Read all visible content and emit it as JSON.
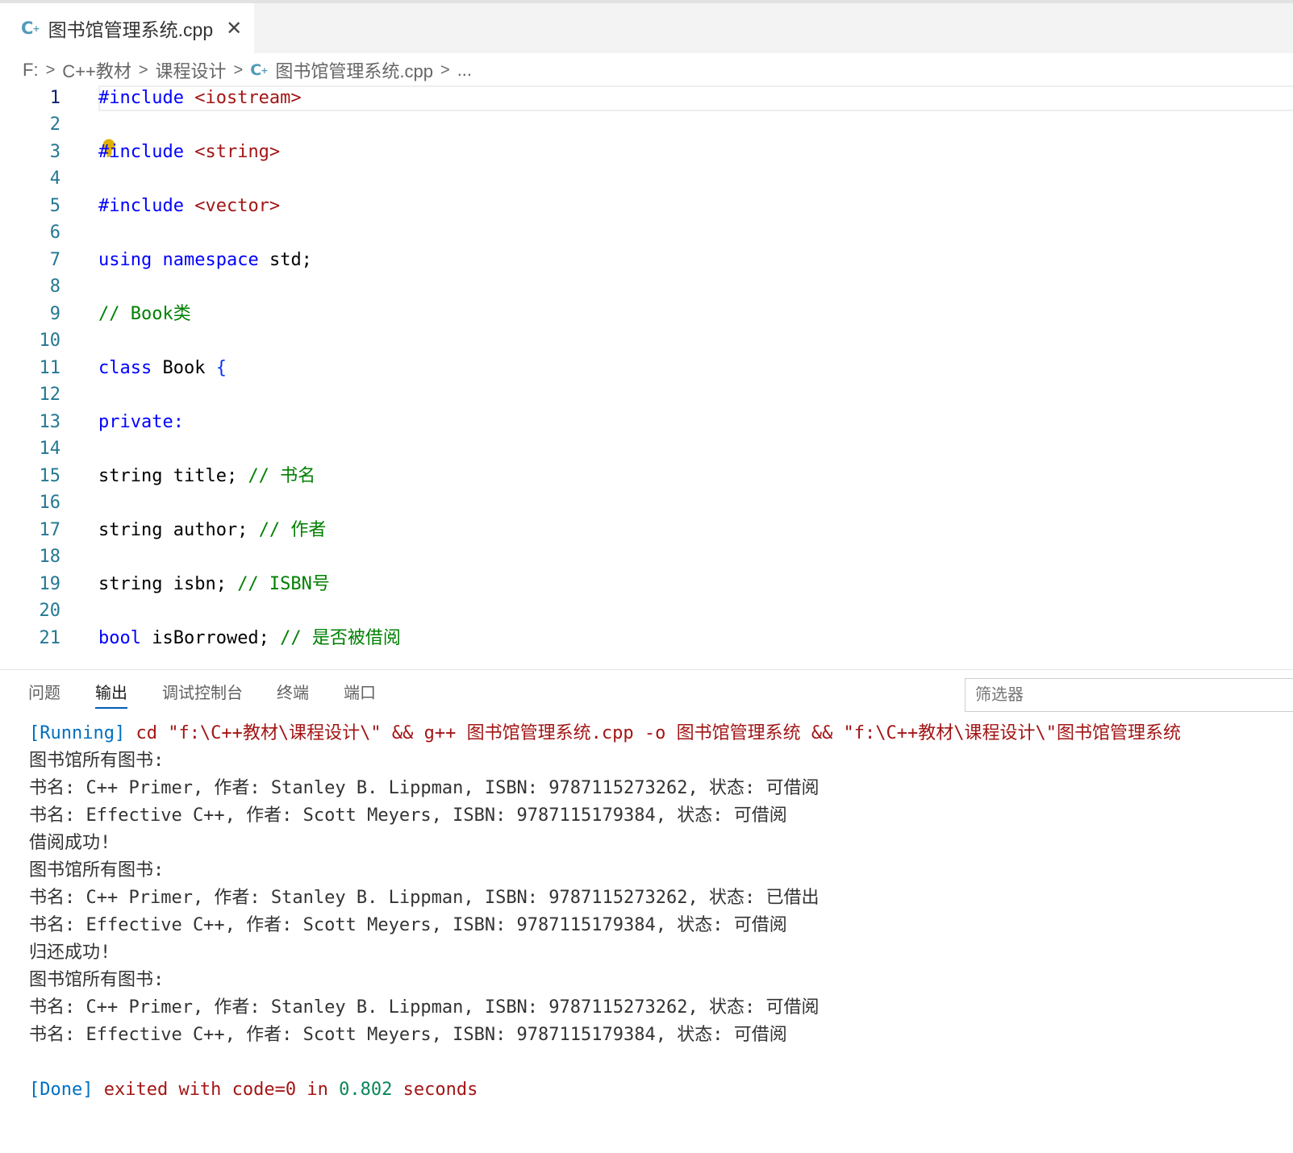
{
  "tab": {
    "icon": "cpp-file-icon",
    "label": "图书馆管理系统.cpp",
    "close": "✕"
  },
  "breadcrumb": {
    "items": [
      "F:",
      "C++教材",
      "课程设计",
      "图书馆管理系统.cpp",
      "..."
    ]
  },
  "editor": {
    "line_numbers": [
      "1",
      "2",
      "3",
      "4",
      "5",
      "6",
      "7",
      "8",
      "9",
      "10",
      "11",
      "12",
      "13",
      "14",
      "15",
      "16",
      "17",
      "18",
      "19",
      "20",
      "21"
    ],
    "lines": {
      "l1": {
        "kw": "#include",
        "inc": " <iostream>"
      },
      "l3": {
        "kw": "#include",
        "inc": " <string>"
      },
      "l5": {
        "kw": "#include",
        "inc": " <vector>"
      },
      "l7": {
        "kw1": "using",
        "sp": " ",
        "kw2": "namespace",
        "rest": " std;"
      },
      "l9": {
        "cm": "// Book类"
      },
      "l11": {
        "kw": "class",
        "rest": " Book ",
        "br": "{"
      },
      "l13": {
        "kw": "private:"
      },
      "l15": {
        "rest": "string title; ",
        "cm": "// 书名"
      },
      "l17": {
        "rest": "string author; ",
        "cm": "// 作者"
      },
      "l19": {
        "rest": "string isbn; ",
        "cm": "// ISBN号"
      },
      "l21": {
        "kw": "bool",
        "rest": " isBorrowed; ",
        "cm": "// 是否被借阅"
      }
    },
    "lightbulb_icon": "lightbulb-icon"
  },
  "panel": {
    "tabs": [
      "问题",
      "输出",
      "调试控制台",
      "终端",
      "端口"
    ],
    "active_tab": "输出",
    "filter_placeholder": "筛选器",
    "output": {
      "running_tag": "[Running]",
      "running_cmd": " cd \"f:\\C++教材\\课程设计\\\" && g++ 图书馆管理系统.cpp -o 图书馆管理系统 && \"f:\\C++教材\\课程设计\\\"图书馆管理系统",
      "lines": [
        "图书馆所有图书:",
        "书名: C++ Primer, 作者: Stanley B. Lippman, ISBN: 9787115273262, 状态: 可借阅",
        "书名: Effective C++, 作者: Scott Meyers, ISBN: 9787115179384, 状态: 可借阅",
        "借阅成功!",
        "图书馆所有图书:",
        "书名: C++ Primer, 作者: Stanley B. Lippman, ISBN: 9787115273262, 状态: 已借出",
        "书名: Effective C++, 作者: Scott Meyers, ISBN: 9787115179384, 状态: 可借阅",
        "归还成功!",
        "图书馆所有图书:",
        "书名: C++ Primer, 作者: Stanley B. Lippman, ISBN: 9787115273262, 状态: 可借阅",
        "书名: Effective C++, 作者: Scott Meyers, ISBN: 9787115179384, 状态: 可借阅"
      ],
      "done_tag": "[Done]",
      "done_a": " exited with ",
      "done_code": "code=0",
      "done_b": " in ",
      "done_time": "0.802",
      "done_c": " seconds"
    }
  }
}
